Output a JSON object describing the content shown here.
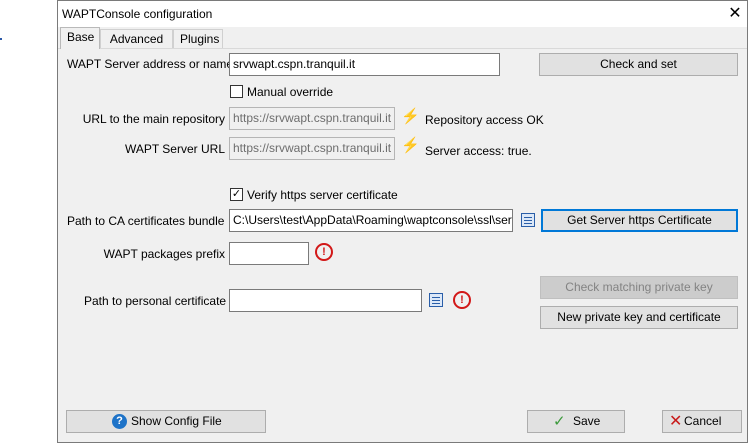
{
  "window": {
    "title": "WAPTConsole configuration",
    "close_glyph": "✕"
  },
  "tabs": [
    {
      "label": "Base",
      "active": true
    },
    {
      "label": "Advanced",
      "active": false
    },
    {
      "label": "Plugins",
      "active": false
    }
  ],
  "server_address": {
    "label": "WAPT Server address or name",
    "value": "srvwapt.cspn.tranquil.it"
  },
  "check_and_set_label": "Check and set",
  "manual_override": {
    "label": "Manual override",
    "checked": false
  },
  "main_repo": {
    "label": "URL to the main repository",
    "value": "https://srvwapt.cspn.tranquil.it",
    "status": "Repository access OK"
  },
  "server_url": {
    "label": "WAPT Server URL",
    "value": "https://srvwapt.cspn.tranquil.it",
    "status": "Server access: true."
  },
  "verify_https": {
    "label": "Verify https server certificate",
    "checked": true
  },
  "ca_bundle": {
    "label": "Path to CA certificates bundle",
    "value": "C:\\Users\\test\\AppData\\Roaming\\waptconsole\\ssl\\server"
  },
  "get_cert_label": "Get Server https Certificate",
  "packages_prefix": {
    "label": "WAPT packages prefix",
    "value": ""
  },
  "check_key_label": "Check matching private key",
  "personal_cert": {
    "label": "Path to personal certificate",
    "value": ""
  },
  "new_key_label": "New  private key and certificate",
  "footer": {
    "show_config_label": "Show Config File",
    "save_label": "Save",
    "cancel_label": "Cancel"
  },
  "icons": {
    "plug": "plug-icon",
    "warning": "warning-icon",
    "file": "file-browse-icon",
    "help": "help-icon",
    "check": "check-icon",
    "cancel": "x-icon"
  },
  "colors": {
    "accent": "#0078d7",
    "ok": "#3aa12b",
    "warning": "#d21818"
  }
}
